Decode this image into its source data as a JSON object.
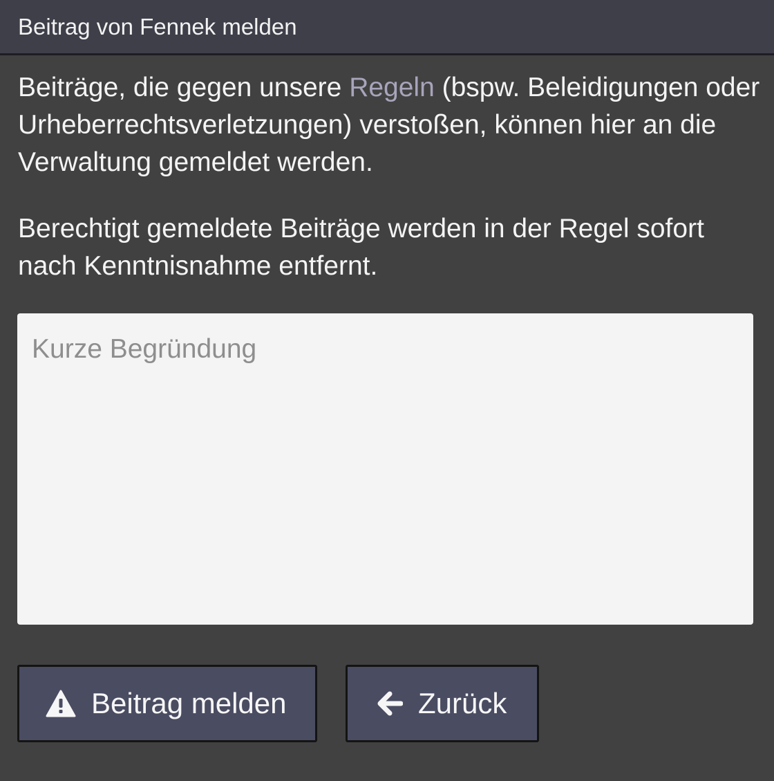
{
  "header": {
    "title": "Beitrag von Fennek melden"
  },
  "intro": {
    "text_before_link": "Beiträge, die gegen unsere ",
    "link_label": "Regeln",
    "text_after_link": " (bspw. Beleidigungen oder Urheberrechtsverletzungen) verstoßen, können hier an die Verwaltung gemeldet werden."
  },
  "notice": {
    "text": "Berechtigt gemeldete Beiträge werden in der Regel sofort nach Kenntnisnahme entfernt."
  },
  "reason_field": {
    "value": "",
    "placeholder": "Kurze Begründung"
  },
  "buttons": {
    "report": {
      "label": "Beitrag melden",
      "icon": "warning-icon"
    },
    "back": {
      "label": "Zurück",
      "icon": "arrow-left-icon"
    }
  },
  "colors": {
    "background": "#414141",
    "header_background": "#3e3f49",
    "link": "#a8a4bb",
    "button_background": "#4a4c62",
    "field_background": "#f4f4f4"
  }
}
